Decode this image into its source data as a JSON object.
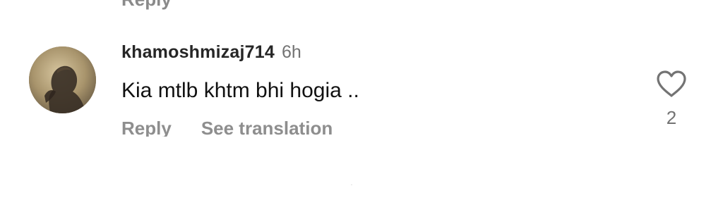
{
  "previous_comment": {
    "reply_label_fragment": "Reply"
  },
  "comment": {
    "username": "khamoshmizaj714",
    "time": "6h",
    "text": "Kia mtlb khtm bhi hogia ..",
    "actions": {
      "reply_label": "Reply",
      "translate_label": "See translation"
    },
    "likes": {
      "icon": "heart-outline-icon",
      "count": "2"
    },
    "avatar": {
      "icon": "profile-photo",
      "colors": [
        "#c9b58a",
        "#8a7a5c",
        "#3a3026"
      ]
    }
  },
  "colors": {
    "background": "#ffffff",
    "username": "#262626",
    "secondary_text": "#737373",
    "action_text": "#8e8e8e",
    "body_text": "#111111"
  }
}
